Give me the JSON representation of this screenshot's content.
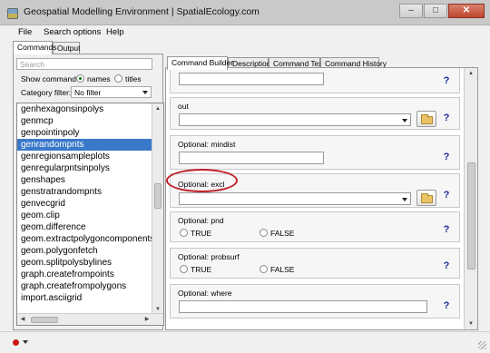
{
  "window": {
    "title": "Geospatial Modelling Environment | SpatialEcology.com"
  },
  "menu": {
    "items": [
      "File",
      "Search options",
      "Help"
    ]
  },
  "outer_tabs": [
    "Commands",
    "Output"
  ],
  "search": {
    "placeholder": "Search"
  },
  "show_command": {
    "label": "Show command",
    "options": [
      "names",
      "titles"
    ],
    "selected": "names"
  },
  "category_filter": {
    "label": "Category filter:",
    "value": "No filter"
  },
  "commands": [
    "genhexagonsinpolys",
    "genmcp",
    "genpointinpoly",
    "genrandompnts",
    "genregionsampleplots",
    "genregularpntsinpolys",
    "genshapes",
    "genstratrandompnts",
    "genvecgrid",
    "geom.clip",
    "geom.difference",
    "geom.extractpolygoncomponents",
    "geom.polygonfetch",
    "geom.splitpolysbylines",
    "graph.createfrompoints",
    "graph.createfrompolygons",
    "import.asciigrid"
  ],
  "selected_command": "genrandompnts",
  "inner_tabs": [
    "Command Builder",
    "Description",
    "Command Text",
    "Command History"
  ],
  "params": {
    "out": {
      "label": "out"
    },
    "mindist": {
      "label": "Optional: mindist"
    },
    "excl": {
      "label": "Optional: excl"
    },
    "pnd": {
      "label": "Optional: pnd",
      "opt_true": "TRUE",
      "opt_false": "FALSE"
    },
    "probsurf": {
      "label": "Optional: probsurf",
      "opt_true": "TRUE",
      "opt_false": "FALSE"
    },
    "where": {
      "label": "Optional: where"
    }
  },
  "help_label": "?",
  "colors": {
    "selection": "#3a79c9",
    "highlight": "#c0202a",
    "help": "#1a2a9a"
  }
}
